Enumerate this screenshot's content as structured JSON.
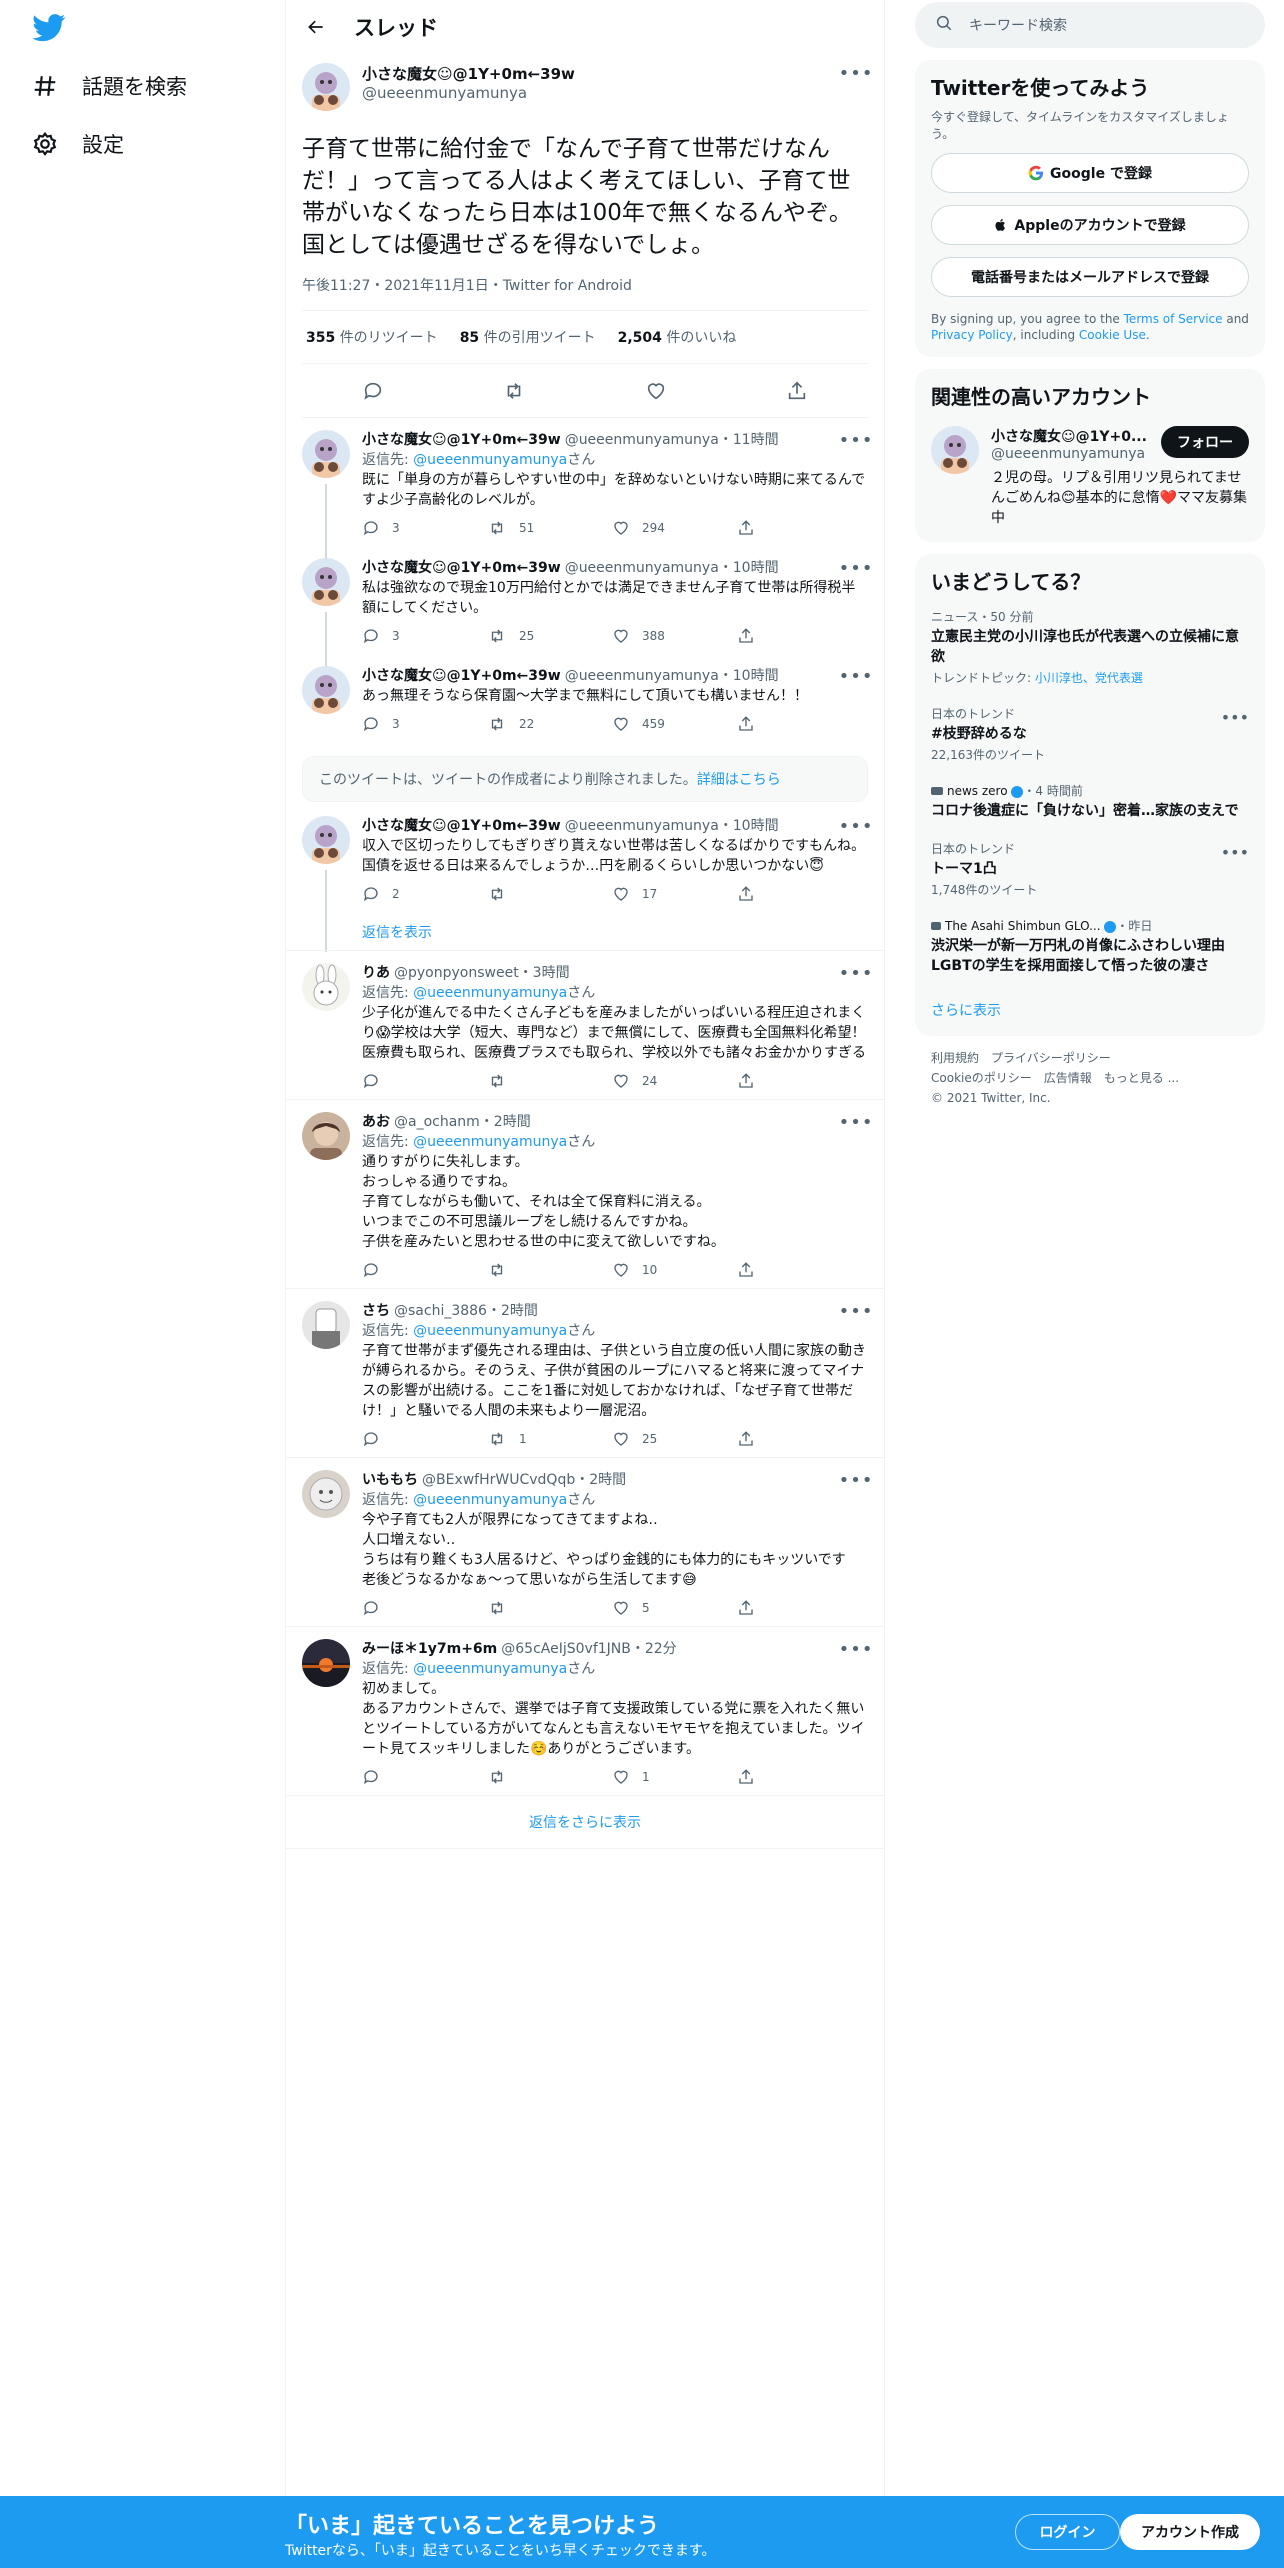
{
  "nav": {
    "explore": "話題を検索",
    "settings": "設定"
  },
  "header": {
    "title": "スレッド"
  },
  "main_tweet": {
    "name": "小さな魔女☺︎@1Y+0m←39w",
    "handle": "@ueeenmunyamunya",
    "text": "子育て世帯に給付金で「なんで子育て世帯だけなんだ！」って言ってる人はよく考えてほしい、子育て世帯がいなくなったら日本は100年で無くなるんやぞ。国としては優遇せざるを得ないでしょ。",
    "meta": "午後11:27・2021年11月1日・Twitter for Android",
    "retweets": "355",
    "retweets_label": "件のリツイート",
    "quotes": "85",
    "quotes_label": "件の引用ツイート",
    "likes": "2,504",
    "likes_label": "件のいいね"
  },
  "replies": [
    {
      "name": "小さな魔女☺︎@1Y+0m←39w",
      "handle": "@ueeenmunyamunya・11時間",
      "reply_prefix": "返信先: ",
      "reply_to": "@ueeenmunyamunya",
      "reply_suffix": "さん",
      "text": "既に「単身の方が暮らしやすい世の中」を辞めないといけない時期に来てるんですよ少子高齢化のレベルが。",
      "reply_count": "3",
      "rt_count": "51",
      "like_count": "294"
    },
    {
      "name": "小さな魔女☺︎@1Y+0m←39w",
      "handle": "@ueeenmunyamunya・10時間",
      "reply_prefix": "",
      "reply_to": "",
      "reply_suffix": "",
      "text": "私は強欲なので現金10万円給付とかでは満足できません子育て世帯は所得税半額にしてください。",
      "reply_count": "3",
      "rt_count": "25",
      "like_count": "388"
    },
    {
      "name": "小さな魔女☺︎@1Y+0m←39w",
      "handle": "@ueeenmunyamunya・10時間",
      "reply_prefix": "",
      "reply_to": "",
      "reply_suffix": "",
      "text": "あっ無理そうなら保育園〜大学まで無料にして頂いても構いません！！",
      "reply_count": "3",
      "rt_count": "22",
      "like_count": "459"
    }
  ],
  "deleted_notice": {
    "text": "このツイートは、ツイートの作成者により削除されました。",
    "link": "詳細はこちら"
  },
  "reply4": {
    "name": "小さな魔女☺︎@1Y+0m←39w",
    "handle": "@ueeenmunyamunya・10時間",
    "text": "収入で区切ったりしてもぎりぎり貰えない世帯は苦しくなるばかりですもんね。\n国債を返せる日は来るんでしょうか…円を刷るくらいしか思いつかない😇",
    "reply_count": "2",
    "rt_count": "",
    "like_count": "17",
    "show_replies": "返信を表示"
  },
  "others": [
    {
      "name": "りあ",
      "handle": "@pyonpyonsweet・3時間",
      "reply_to": "@ueeenmunyamunya",
      "text": "少子化が進んでる中たくさん子どもを産みましたがいっぱいいる程圧迫されまくり😱学校は大学（短大、専門など）まで無償にして、医療費も全国無料化希望！医療費も取られ、医療費プラスでも取られ、学校以外でも諸々お金かかりすぎる",
      "reply_count": "",
      "rt_count": "",
      "like_count": "24"
    },
    {
      "name": "あお",
      "handle": "@a_ochanm・2時間",
      "reply_to": "@ueeenmunyamunya",
      "text": "通りすがりに失礼します。\nおっしゃる通りですね。\n子育てしながらも働いて、それは全て保育料に消える。\nいつまでこの不可思議ループをし続けるんですかね。\n子供を産みたいと思わせる世の中に変えて欲しいですね。",
      "reply_count": "",
      "rt_count": "",
      "like_count": "10"
    },
    {
      "name": "さち",
      "handle": "@sachi_3886・2時間",
      "reply_to": "@ueeenmunyamunya",
      "text": "子育て世帯がまず優先される理由は、子供という自立度の低い人間に家族の動きが縛られるから。そのうえ、子供が貧困のループにハマると将来に渡ってマイナスの影響が出続ける。ここを1番に対処しておかなければ、「なぜ子育て世帯だけ！」と騒いでる人間の未来もより一層泥沼。",
      "reply_count": "",
      "rt_count": "1",
      "like_count": "25"
    },
    {
      "name": "いももち",
      "handle": "@BExwfHrWUCvdQqb・2時間",
      "reply_to": "@ueeenmunyamunya",
      "text": "今や子育ても2人が限界になってきてますよね‥\n人口増えない‥\nうちは有り難くも3人居るけど、やっぱり金銭的にも体力的にもキッツいです\n老後どうなるかなぁ〜って思いながら生活してます😅",
      "reply_count": "",
      "rt_count": "",
      "like_count": "5"
    },
    {
      "name": "みーほ＊1y7m+6m",
      "handle": "@65cAeIjS0vf1JNB・22分",
      "reply_to": "@ueeenmunyamunya",
      "text": "初めまして。\nあるアカウントさんで、選挙では子育て支援政策している党に票を入れたく無いとツイートしている方がいてなんとも言えないモヤモヤを抱えていました。ツイート見てスッキリしました☺️ありがとうございます。",
      "reply_count": "",
      "rt_count": "",
      "like_count": "1"
    }
  ],
  "reply_prefix": "返信先: ",
  "reply_suffix": "さん",
  "show_more_replies": "返信をさらに表示",
  "search": {
    "placeholder": "キーワード検索"
  },
  "signup": {
    "title": "Twitterを使ってみよう",
    "sub": "今すぐ登録して、タイムラインをカスタマイズしましょう。",
    "google": "Google で登録",
    "apple": "Appleのアカウントで登録",
    "phone": "電話番号またはメールアドレスで登録",
    "terms_pre": "By signing up, you agree to the ",
    "terms_tos": "Terms of Service",
    "terms_and": " and ",
    "terms_privacy": "Privacy Policy",
    "terms_including": ", including ",
    "terms_cookie": "Cookie Use",
    "terms_end": "."
  },
  "related": {
    "title": "関連性の高いアカウント",
    "name": "小さな魔女☺︎@1Y+0...",
    "handle": "@ueeenmunyamunya",
    "follow": "フォロー",
    "bio": "２児の母。リプ＆引用リツ見られてませんごめんね😊基本的に怠惰❤️ママ友募集中"
  },
  "trends": {
    "title": "いまどうしてる？",
    "items": [
      {
        "cat": "ニュース・50 分前",
        "name": "立憲民主党の小川淳也氏が代表選への立候補に意欲",
        "sub_pre": "トレンドトピック: ",
        "sub_link": "小川淳也、党代表選"
      },
      {
        "cat": "日本のトレンド",
        "name": "#枝野辞めるな",
        "sub": "22,163件のツイート"
      },
      {
        "cat_source": "news zero",
        "cat_time": "・4 時間前",
        "name": "コロナ後遺症に「負けない」密着…家族の支えで"
      },
      {
        "cat": "日本のトレンド",
        "name": "トーマ1凸",
        "sub": "1,748件のツイート"
      },
      {
        "cat_source": "The Asahi Shimbun GLO...",
        "cat_time": "・昨日",
        "name": "渋沢栄一が新一万円札の肖像にふさわしい理由　LGBTの学生を採用面接して悟った彼の凄さ"
      }
    ],
    "show_more": "さらに表示"
  },
  "footer": {
    "l1a": "利用規約",
    "l1b": "プライバシーポリシー",
    "l2a": "Cookieのポリシー",
    "l2b": "広告情報",
    "l2c": "もっと見る ...",
    "copy": "© 2021 Twitter, Inc."
  },
  "bottom_bar": {
    "title": "「いま」起きていることを見つけよう",
    "sub": "Twitterなら、「いま」起きていることをいち早くチェックできます。",
    "login": "ログイン",
    "signup": "アカウント作成"
  },
  "colors": {
    "accent": "#1d9bf0",
    "bottom_bar": "#1d9bf0"
  }
}
